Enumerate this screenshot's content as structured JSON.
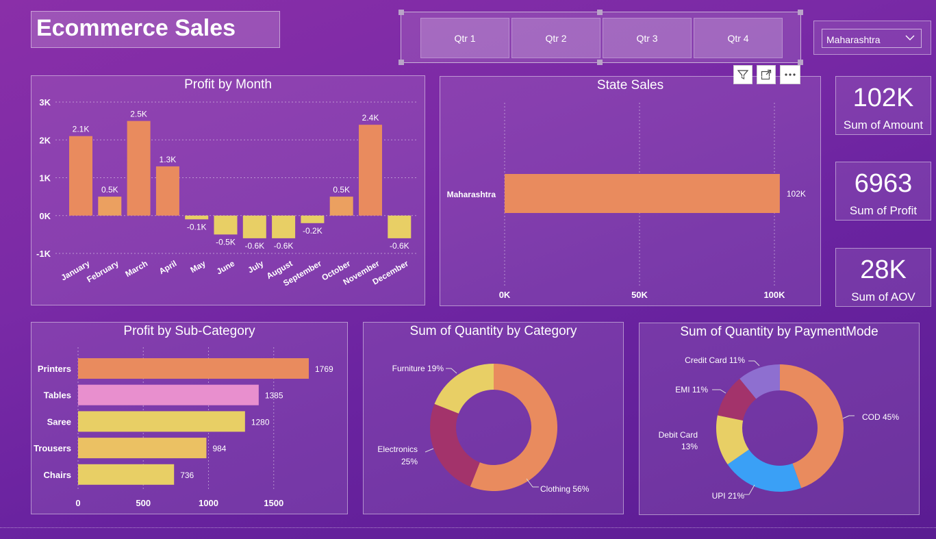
{
  "title": "Ecommerce Sales",
  "quarters": [
    "Qtr 1",
    "Qtr 2",
    "Qtr 3",
    "Qtr 4"
  ],
  "state_filter": {
    "selected": "Maharashtra"
  },
  "kpis": [
    {
      "value": "102K",
      "label": "Sum of Amount"
    },
    {
      "value": "6963",
      "label": "Sum of Profit"
    },
    {
      "value": "28K",
      "label": "Sum of AOV"
    }
  ],
  "colors": {
    "orange": "#e98b5e",
    "yellow": "#e8cf65",
    "pink": "#e88fce",
    "crimson": "#a3336b",
    "blue": "#3aa0f6",
    "lavender": "#8e6fd0"
  },
  "chart_data": [
    {
      "type": "bar",
      "title": "Profit by Month",
      "categories": [
        "January",
        "February",
        "March",
        "April",
        "May",
        "June",
        "July",
        "August",
        "September",
        "October",
        "November",
        "December"
      ],
      "values": [
        2.1,
        0.5,
        2.5,
        1.3,
        -0.1,
        -0.5,
        -0.6,
        -0.6,
        -0.2,
        0.5,
        2.4,
        -0.6
      ],
      "data_labels": [
        "2.1K",
        "0.5K",
        "2.5K",
        "1.3K",
        "-0.1K",
        "-0.5K",
        "-0.6K",
        "-0.6K",
        "-0.2K",
        "0.5K",
        "2.4K",
        "-0.6K"
      ],
      "y_ticks": [
        "3K",
        "2K",
        "1K",
        "0K",
        "-1K"
      ],
      "ylim": [
        -1,
        3
      ],
      "grid": true
    },
    {
      "type": "bar",
      "title": "State Sales",
      "orientation": "horizontal",
      "categories": [
        "Maharashtra"
      ],
      "values": [
        102
      ],
      "data_labels": [
        "102K"
      ],
      "x_ticks": [
        "0K",
        "50K",
        "100K"
      ],
      "xlim": [
        0,
        100
      ],
      "grid": true
    },
    {
      "type": "bar",
      "title": "Profit by Sub-Category",
      "orientation": "horizontal",
      "categories": [
        "Printers",
        "Tables",
        "Saree",
        "Trousers",
        "Chairs"
      ],
      "values": [
        1769,
        1385,
        1280,
        984,
        736
      ],
      "data_labels": [
        "1769",
        "1385",
        "1280",
        "984",
        "736"
      ],
      "x_ticks": [
        "0",
        "500",
        "1000",
        "1500"
      ],
      "xlim": [
        0,
        1500
      ],
      "grid": true
    },
    {
      "type": "pie",
      "title": "Sum of Quantity by Category",
      "labels": [
        "Clothing",
        "Electronics",
        "Furniture"
      ],
      "values": [
        56,
        25,
        19
      ],
      "slice_labels": [
        "Clothing 56%",
        "Electronics 25%",
        "Furniture 19%"
      ]
    },
    {
      "type": "pie",
      "title": "Sum of Quantity by PaymentMode",
      "labels": [
        "COD",
        "UPI",
        "Debit Card",
        "EMI",
        "Credit Card"
      ],
      "values": [
        45,
        21,
        13,
        11,
        11
      ],
      "slice_labels": [
        "COD 45%",
        "UPI 21%",
        "Debit Card 13%",
        "EMI 11%",
        "Credit Card 11%"
      ]
    }
  ]
}
